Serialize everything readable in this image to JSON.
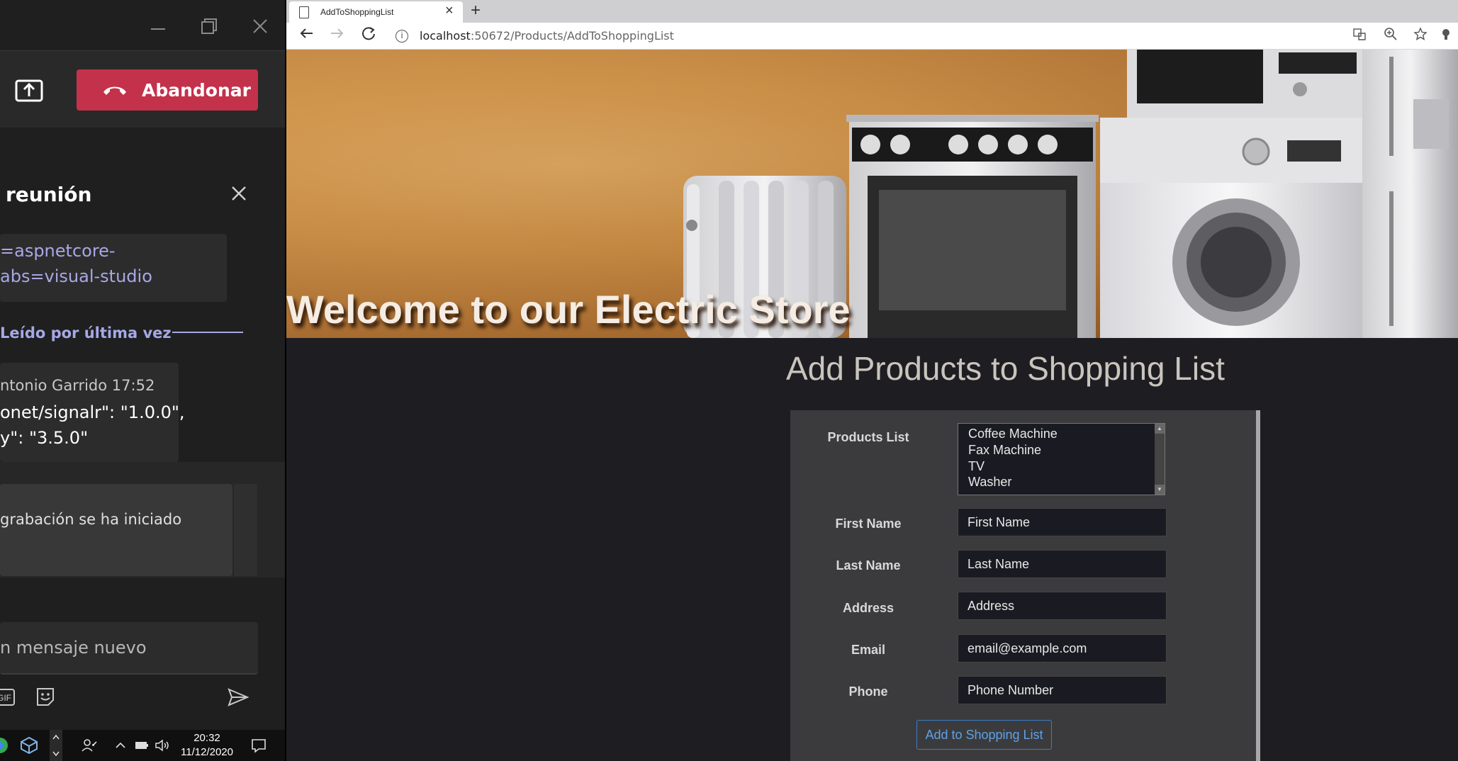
{
  "teams": {
    "leave_label": "Abandonar",
    "chat_title": "reunión",
    "link_lines": [
      "=aspnetcore-",
      "abs=visual-studio"
    ],
    "last_read_label": "Leído por última vez",
    "message": {
      "author_time": "ntonio Garrido     17:52",
      "lines": [
        "onet/signalr\": \"1.0.0\",",
        "y\": \"3.5.0\""
      ]
    },
    "system_message": "grabación se ha iniciado",
    "composer_placeholder": "n mensaje nuevo",
    "gif_label": "GIF"
  },
  "taskbar": {
    "time": "20:32",
    "date": "11/12/2020"
  },
  "browser": {
    "tab_title": "AddToShoppingList",
    "url_host": "localhost",
    "url_path": ":50672/Products/AddToShoppingList"
  },
  "site": {
    "banner_title": "Welcome to our Electric Store",
    "page_title": "Add Products to Shopping List",
    "form": {
      "products_label": "Products List",
      "products": [
        "Coffee Machine",
        "Fax Machine",
        "TV",
        "Washer"
      ],
      "first_name_label": "First Name",
      "first_name_placeholder": "First Name",
      "last_name_label": "Last Name",
      "last_name_placeholder": "Last Name",
      "address_label": "Address",
      "address_placeholder": "Address",
      "email_label": "Email",
      "email_placeholder": "email@example.com",
      "phone_label": "Phone",
      "phone_placeholder": "Phone Number",
      "submit_label": "Add to Shopping List"
    }
  },
  "colors": {
    "leave_red": "#c4314b",
    "teams_accent": "#a6a8e6",
    "link_blue": "#5ea1e6"
  }
}
